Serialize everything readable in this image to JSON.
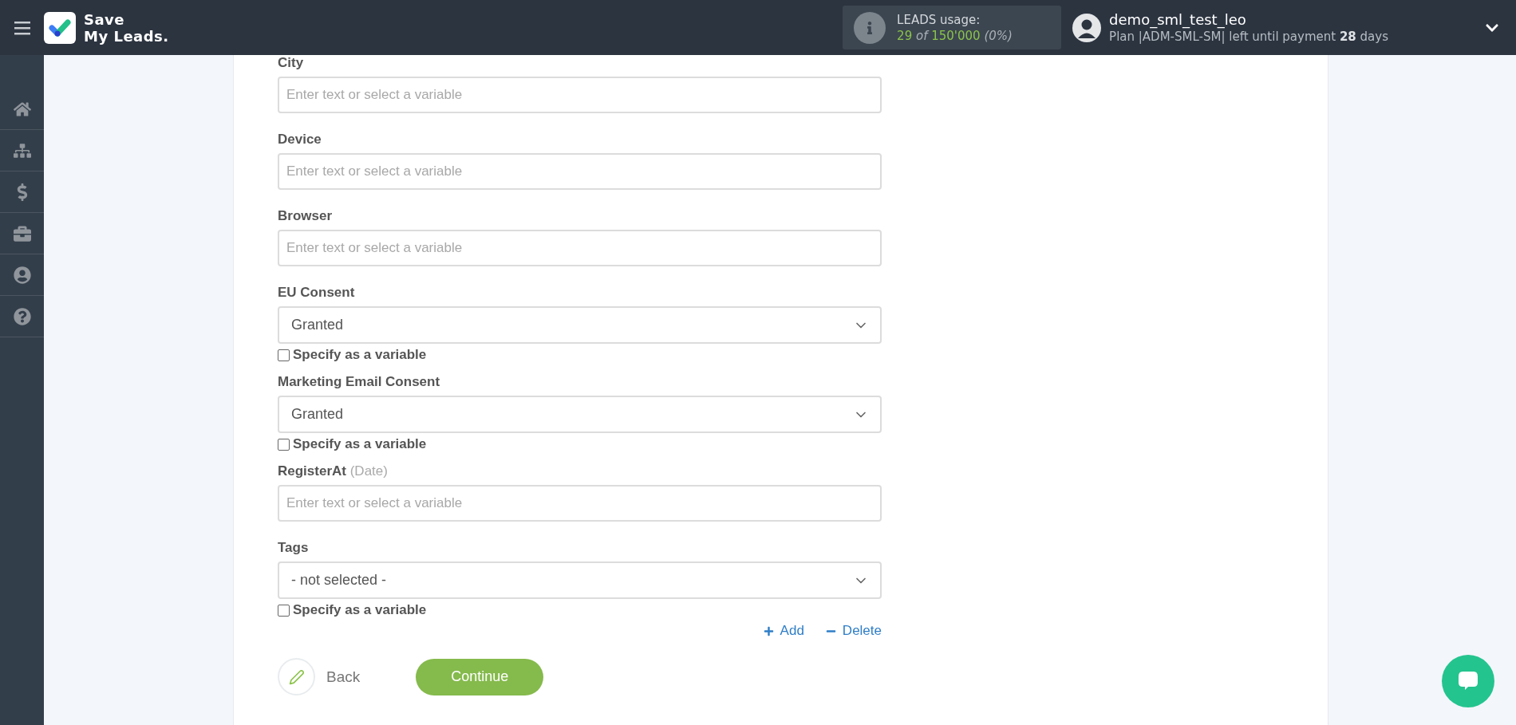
{
  "header": {
    "logo": {
      "line1": "Save",
      "line2": "My Leads."
    },
    "usage": {
      "title": "LEADS usage:",
      "used": "29",
      "of": "of",
      "total": "150'000",
      "percent": "(0%)"
    },
    "user": {
      "name": "demo_sml_test_leo",
      "plan_prefix": "Plan |ADM-SML-SM| left until payment",
      "days": "28",
      "days_suffix": "days"
    }
  },
  "sidebar": {
    "items": [
      {
        "kind": "home",
        "selected": false
      },
      {
        "kind": "sitemap",
        "selected": false
      },
      {
        "kind": "dollar",
        "selected": false
      },
      {
        "kind": "briefcase",
        "selected": false
      },
      {
        "kind": "user",
        "selected": false
      },
      {
        "kind": "help",
        "selected": false
      }
    ]
  },
  "form": {
    "fields": [
      {
        "kind": "input",
        "label": "City",
        "placeholder": "Enter text or select a variable"
      },
      {
        "kind": "input",
        "label": "Device",
        "placeholder": "Enter text or select a variable"
      },
      {
        "kind": "input",
        "label": "Browser",
        "placeholder": "Enter text or select a variable"
      },
      {
        "kind": "select",
        "label": "EU Consent",
        "value": "Granted",
        "specify": {
          "label": "Specify as a variable",
          "checked": false
        }
      },
      {
        "kind": "select",
        "label": "Marketing Email Consent",
        "value": "Granted",
        "specify": {
          "label": "Specify as a variable",
          "checked": false
        }
      },
      {
        "kind": "input",
        "label": "RegisterAt",
        "hint": "(Date)",
        "placeholder": "Enter text or select a variable"
      },
      {
        "kind": "select",
        "label": "Tags",
        "value": "- not selected -",
        "specify": {
          "label": "Specify as a variable",
          "checked": false
        }
      }
    ],
    "add": "Add",
    "delete": "Delete",
    "back": "Back",
    "continue": "Continue"
  }
}
